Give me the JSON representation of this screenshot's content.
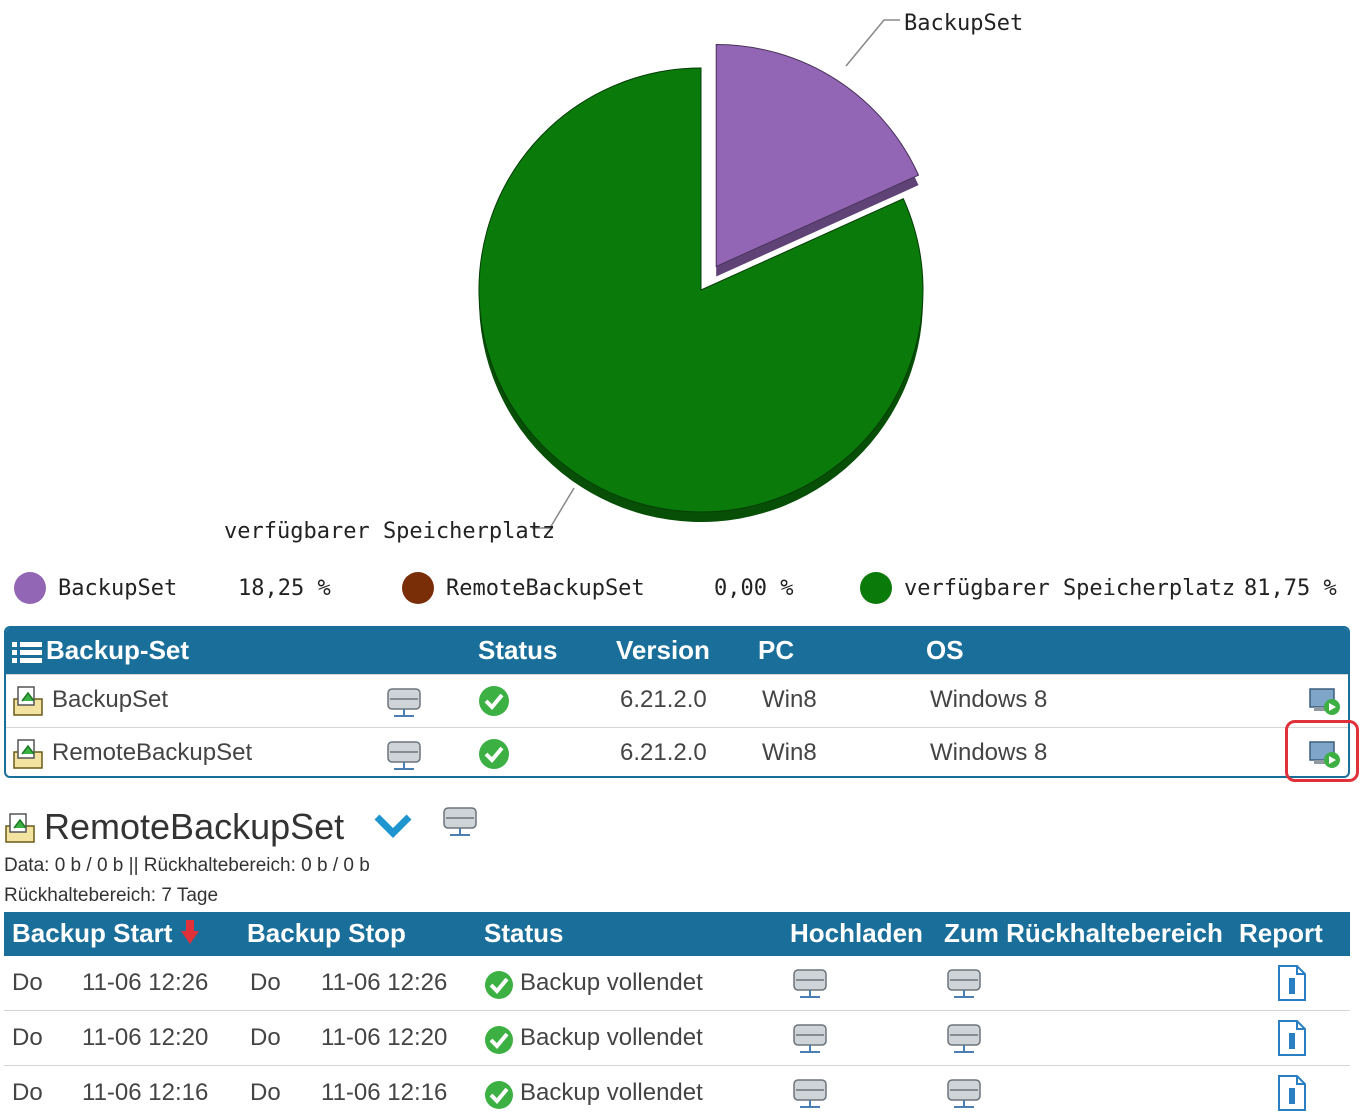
{
  "chart_data": {
    "type": "pie",
    "slices": [
      {
        "name": "BackupSet",
        "value": 18.25,
        "color": "#9266b5",
        "exploded": true
      },
      {
        "name": "RemoteBackupSet",
        "value": 0.0,
        "color": "#7a2e08"
      },
      {
        "name": "verfügbarer Speicherplatz",
        "value": 81.75,
        "color": "#0a7a0a"
      }
    ],
    "labels": [
      "BackupSet",
      "verfügbarer Speicherplatz"
    ]
  },
  "legend": [
    {
      "label": "BackupSet",
      "value": "18,25 %",
      "color": "#9266b5"
    },
    {
      "label": "RemoteBackupSet",
      "value": "0,00 %",
      "color": "#7a2e08"
    },
    {
      "label": "verfügbarer Speicherplatz",
      "value": "81,75 %",
      "color": "#0a7a0a"
    }
  ],
  "set_table": {
    "headers": {
      "name": "Backup-Set",
      "status": "Status",
      "version": "Version",
      "pc": "PC",
      "os": "OS"
    },
    "rows": [
      {
        "name": "BackupSet",
        "version": "6.21.2.0",
        "pc": "Win8",
        "os": "Windows 8"
      },
      {
        "name": "RemoteBackupSet",
        "version": "6.21.2.0",
        "pc": "Win8",
        "os": "Windows 8"
      }
    ]
  },
  "detail": {
    "title": "RemoteBackupSet",
    "data_line": "Data: 0 b / 0 b  ||  Rückhaltebereich: 0 b / 0 b",
    "retention_line": "Rückhaltebereich: 7 Tage"
  },
  "history": {
    "headers": {
      "start": "Backup Start",
      "stop": "Backup Stop",
      "status": "Status",
      "upload": "Hochladen",
      "retention": "Zum Rückhaltebereich",
      "report": "Report"
    },
    "rows": [
      {
        "start_day": "Do",
        "start_time": "11-06 12:26",
        "stop_day": "Do",
        "stop_time": "11-06 12:26",
        "status": "Backup vollendet"
      },
      {
        "start_day": "Do",
        "start_time": "11-06 12:20",
        "stop_day": "Do",
        "stop_time": "11-06 12:20",
        "status": "Backup vollendet"
      },
      {
        "start_day": "Do",
        "start_time": "11-06 12:16",
        "stop_day": "Do",
        "stop_time": "11-06 12:16",
        "status": "Backup vollendet"
      }
    ]
  },
  "colors": {
    "header": "#1a6e9a",
    "check": "#3cb043",
    "highlight": "#e0313a",
    "accent_chevron": "#1f95d0"
  }
}
